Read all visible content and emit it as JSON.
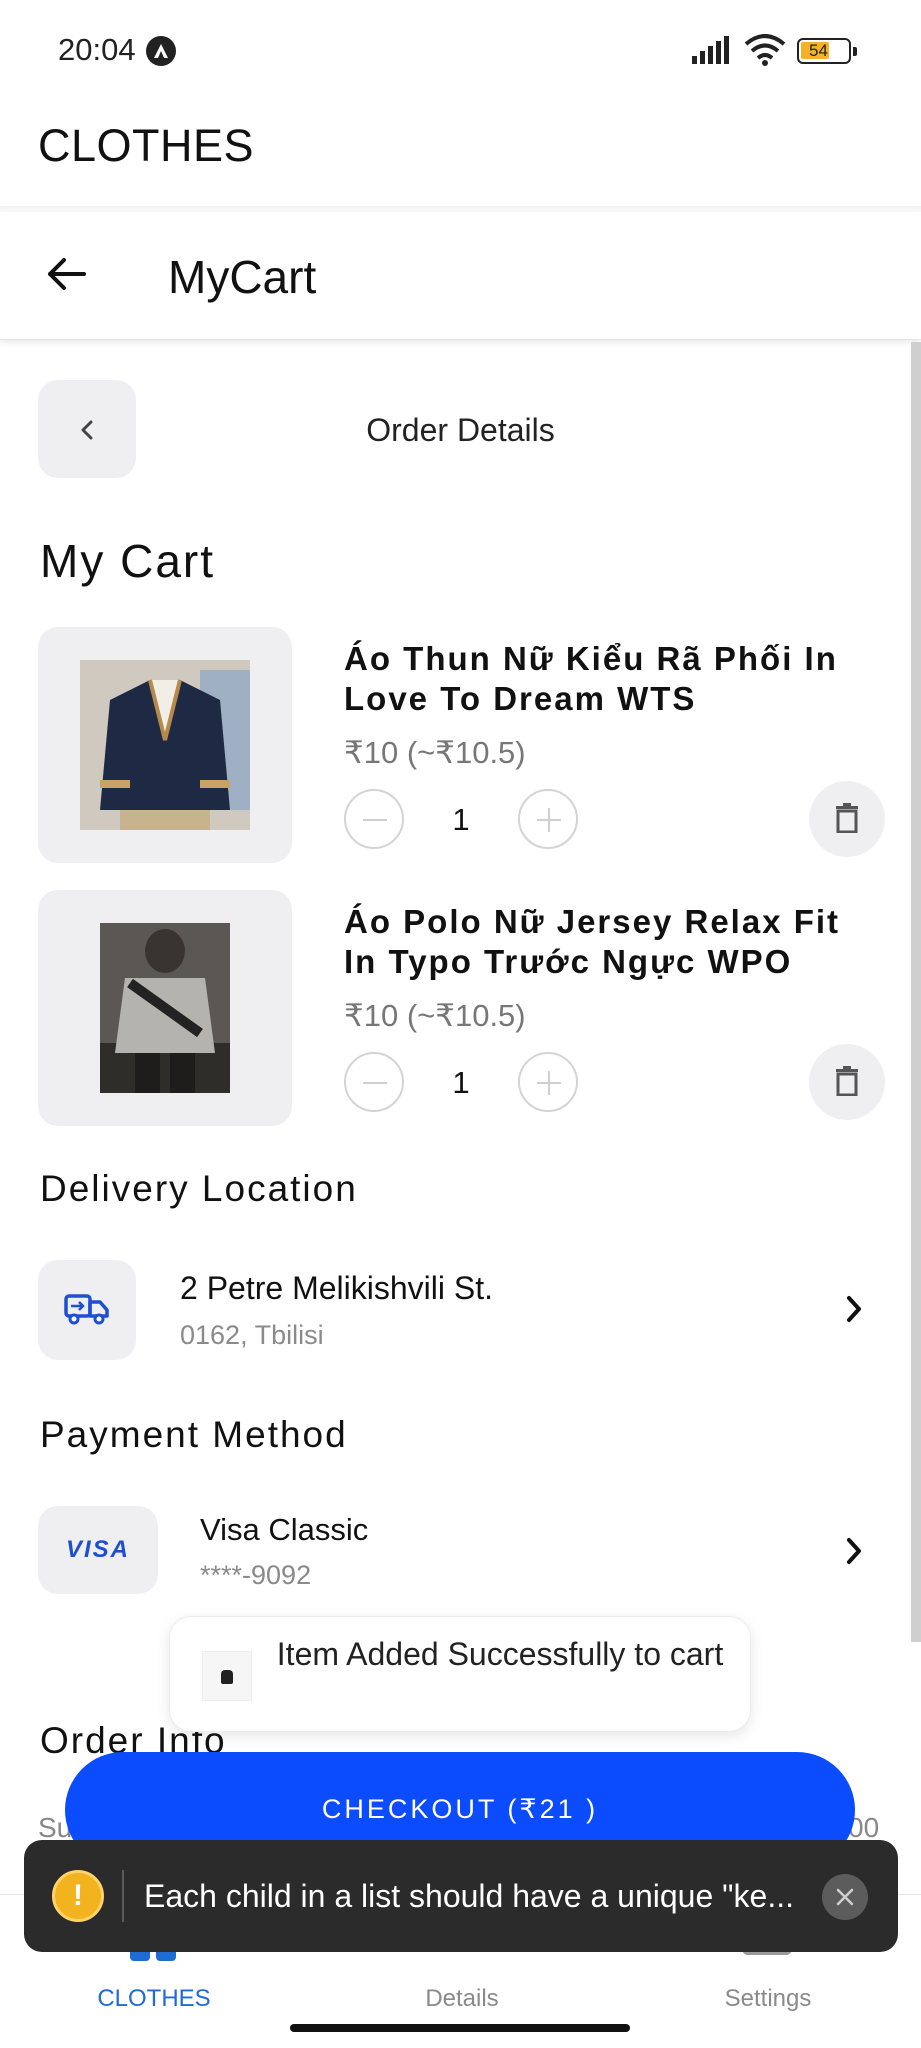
{
  "status_bar": {
    "time": "20:04",
    "battery": "54",
    "battery_color": "#f3b227"
  },
  "app": {
    "title": "CLOTHES"
  },
  "navbar": {
    "title": "MyCart",
    "back_icon": "arrow-left-icon"
  },
  "order_details": {
    "title": "Order Details",
    "back_icon": "chevron-left-icon"
  },
  "cart": {
    "section_title": "My Cart",
    "items": [
      {
        "name": "Áo Thun Nữ Kiểu Rã Phối In Love To Dream WTS",
        "price": "₹10 (~₹10.5)",
        "quantity": "1"
      },
      {
        "name": "Áo Polo Nữ Jersey Relax Fit In Typo Trước Ngực WPO",
        "price": "₹10 (~₹10.5)",
        "quantity": "1"
      }
    ]
  },
  "delivery": {
    "section_title": "Delivery Location",
    "address_line1": "2 Petre Melikishvili St.",
    "address_line2": "0162, Tbilisi",
    "icon": "delivery-truck-icon"
  },
  "payment": {
    "section_title": "Payment Method",
    "brand": "VISA",
    "card_name": "Visa Classic",
    "card_number": "****-9092",
    "brand_color": "#1f4fd1"
  },
  "toast": {
    "message": "Item Added Successfully to cart"
  },
  "order_info": {
    "section_title": "Order Info",
    "summary_label_partial": "Su",
    "summary_value_partial": "00"
  },
  "checkout": {
    "label": "CHECKOUT (₹21 )",
    "color": "#0b4cff"
  },
  "error_banner": {
    "icon": "!",
    "message": "Each child in a list should have a unique \"ke..."
  },
  "bottom_nav": {
    "items": [
      {
        "label": "CLOTHES",
        "active": true
      },
      {
        "label": "Details",
        "active": false
      },
      {
        "label": "Settings",
        "active": false
      }
    ],
    "active_color": "#1f6bd6"
  }
}
